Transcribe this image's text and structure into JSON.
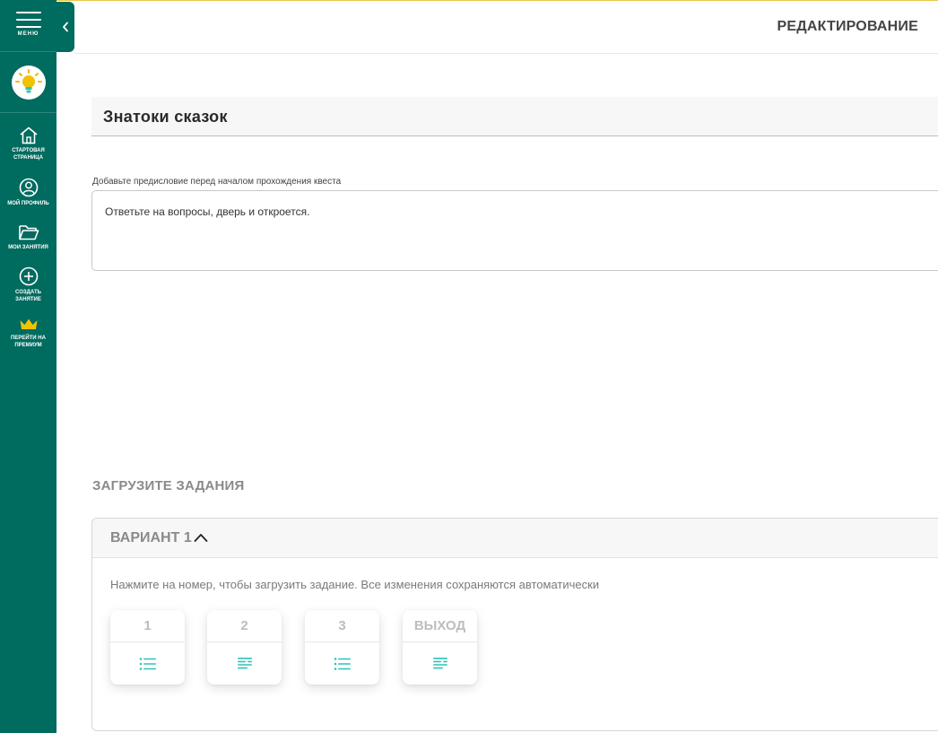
{
  "sidebar": {
    "menu_label": "МЕНЮ",
    "items": [
      {
        "label": "СТАРТОВАЯ СТРАНИЦА",
        "icon": "home-icon"
      },
      {
        "label": "МОЙ ПРОФИЛЬ",
        "icon": "user-icon"
      },
      {
        "label": "МОИ ЗАНЯТИЯ",
        "icon": "folder-icon"
      },
      {
        "label": "СОЗДАТЬ ЗАНЯТИЕ",
        "icon": "plus-circle-icon"
      },
      {
        "label": "ПЕРЕЙТИ НА ПРЕМИУМ",
        "icon": "crown-icon"
      }
    ]
  },
  "header": {
    "title": "РЕДАКТИРОВАНИЕ"
  },
  "quest": {
    "title": "Знатоки сказок",
    "preface_label": "Добавьте предисловие перед началом прохождения квеста",
    "preface_text": "Ответьте на вопросы, дверь и откроется."
  },
  "tasks_section": {
    "heading": "ЗАГРУЗИТЕ ЗАДАНИЯ",
    "variant_title": "ВАРИАНТ 1",
    "hint": "Нажмите на номер, чтобы загрузить задание. Все изменения сохраняются автоматически",
    "tiles": [
      {
        "label": "1",
        "icon": "list-icon"
      },
      {
        "label": "2",
        "icon": "text-lines-icon"
      },
      {
        "label": "3",
        "icon": "list-icon"
      },
      {
        "label": "ВЫХОД",
        "icon": "text-lines-icon"
      }
    ]
  },
  "colors": {
    "sidebar": "#006b5f",
    "accent_icon": "#2ec4b6",
    "premium": "#f2c200"
  }
}
